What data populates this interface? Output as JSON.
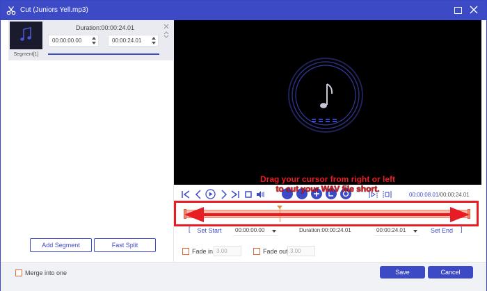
{
  "window": {
    "title": "Cut (Juniors Yell.mp3)"
  },
  "colors": {
    "accent": "#3d4ac6",
    "annotation": "#e81c24",
    "checkbox_border": "#e06a3a",
    "timeline_fill": "#f7b9a8"
  },
  "segment": {
    "label": "Segment[1]",
    "duration": "Duration:00:00:24.01",
    "start": "00:00:00.00",
    "end": "00:00:24.01"
  },
  "left_buttons": {
    "add_segment": "Add Segment",
    "fast_split": "Fast Split"
  },
  "annotation": {
    "line1": "Drag your cursor from right or left",
    "line2": "to cut your WAV file short."
  },
  "playback": {
    "current_time": "00:00:08.01",
    "total_time": "/00:00:24.01",
    "position_fraction": 0.334
  },
  "trim": {
    "set_start_label": "Set Start",
    "start_value": "00:00:00.00",
    "duration_label": "Duration:00:00:24.01",
    "end_value": "00:00:24.01",
    "set_end_label": "Set End"
  },
  "fade": {
    "fade_in_label": "Fade in",
    "fade_in_value": "3.00",
    "fade_out_label": "Fade out",
    "fade_out_value": "3.00"
  },
  "footer": {
    "merge_label": "Merge into one",
    "save_label": "Save",
    "cancel_label": "Cancel"
  },
  "icons": [
    "scissors-icon",
    "maximize-icon",
    "close-icon",
    "music-note-icon",
    "jump-start-icon",
    "prev-frame-icon",
    "play-icon",
    "next-frame-icon",
    "jump-end-icon",
    "stop-icon",
    "volume-icon",
    "snapshot-icon",
    "loop-icon",
    "add-icon",
    "rotate-icon",
    "refresh-icon",
    "mark-in-icon",
    "mark-out-icon"
  ]
}
